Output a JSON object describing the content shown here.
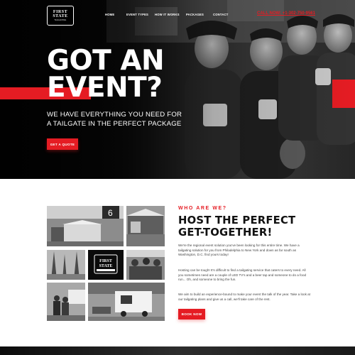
{
  "logo": {
    "line1": "FIRST",
    "line2": "STATE",
    "tagline": "TAILGATING",
    "icon": "first-state-logo"
  },
  "nav": {
    "items": [
      {
        "label": "HOME"
      },
      {
        "label": "EVENT TYPES"
      },
      {
        "label": "HOW IT WORKS"
      },
      {
        "label": "PACKAGES"
      },
      {
        "label": "CONTACT"
      }
    ],
    "call_label": "CALL NOW: +1-302-750-9561"
  },
  "hero": {
    "title_line1": "GOT AN",
    "title_line2": "EVENT?",
    "subtitle_line1": "WE HAVE EVERYTHING YOU NEED FOR",
    "subtitle_line2": "A TAILGATE IN THE PERFECT PACKAGE",
    "button_label": "GET A QUOTE"
  },
  "about": {
    "eyebrow": "WHO ARE WE?",
    "title_line1": "HOST THE PERFECT",
    "title_line2": "GET-TOGETHER!",
    "paragraphs": [
      "We're the regional event solution you've been looking for this entire time. We have a tailgating solution for you from Philadelphia to New York and down as far south as Washington, D.C. find yours today!",
      "Hosting can be tough! It's difficult to find a tailgating service that caters to every need. All you sometimes need are a couple of LED TV's and a beer tap and someone to do a food run... Oh, and someone to bring the fun.",
      "We aim to build an experience-bound to make your event the talk of the year. Take a look at our tailgating plans and give us a call, we'll take care of the rest."
    ],
    "button_label": "BOOK NOW"
  },
  "colors": {
    "accent": "#e51c23",
    "dark": "#111111",
    "text": "#444444"
  }
}
